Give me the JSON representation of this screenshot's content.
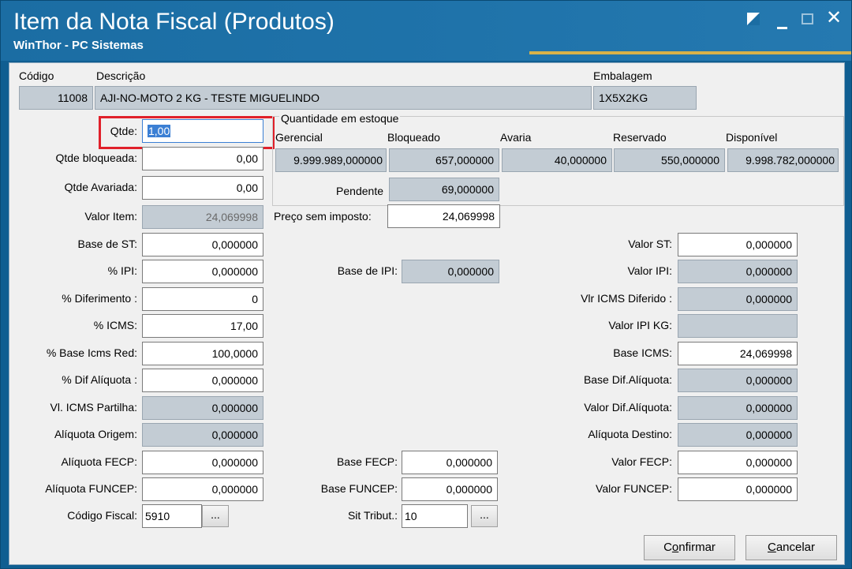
{
  "window": {
    "title": "Item da Nota Fiscal (Produtos)",
    "subtitle": "WinThor - PC Sistemas"
  },
  "header": {
    "codigo_label": "Código",
    "codigo_value": "11008",
    "descricao_label": "Descrição",
    "descricao_value": "AJI-NO-MOTO 2 KG - TESTE MIGUELINDO",
    "embalagem_label": "Embalagem",
    "embalagem_value": "1X5X2KG"
  },
  "left": {
    "qtde_label": "Qtde:",
    "qtde_value": "1,00",
    "qtde_bloqueada_label": "Qtde bloqueada:",
    "qtde_bloqueada_value": "0,00",
    "qtde_avariada_label": "Qtde Avariada:",
    "qtde_avariada_value": "0,00",
    "valor_item_label": "Valor Item:",
    "valor_item_value": "24,069998",
    "base_st_label": "Base de ST:",
    "base_st_value": "0,000000",
    "pct_ipi_label": "% IPI:",
    "pct_ipi_value": "0,000000",
    "pct_diferimento_label": "% Diferimento :",
    "pct_diferimento_value": "0",
    "pct_icms_label": "% ICMS:",
    "pct_icms_value": "17,00",
    "pct_base_icms_red_label": "% Base Icms Red:",
    "pct_base_icms_red_value": "100,0000",
    "pct_dif_aliquota_label": "% Dif Alíquota :",
    "pct_dif_aliquota_value": "0,000000",
    "vl_icms_partilha_label": "Vl. ICMS Partilha:",
    "vl_icms_partilha_value": "0,000000",
    "aliquota_origem_label": "Alíquota Origem:",
    "aliquota_origem_value": "0,000000",
    "aliquota_fecp_label": "Alíquota FECP:",
    "aliquota_fecp_value": "0,000000",
    "aliquota_funcep_label": "Alíquota FUNCEP:",
    "aliquota_funcep_value": "0,000000",
    "codigo_fiscal_label": "Código Fiscal:",
    "codigo_fiscal_value": "5910",
    "codigo_fiscal_button": "..."
  },
  "stock": {
    "group_title": "Quantidade em estoque",
    "gerencial_label": "Gerencial",
    "gerencial_value": "9.999.989,000000",
    "bloqueado_label": "Bloqueado",
    "bloqueado_value": "657,000000",
    "avaria_label": "Avaria",
    "avaria_value": "40,000000",
    "reservado_label": "Reservado",
    "reservado_value": "550,000000",
    "disponivel_label": "Disponível",
    "disponivel_value": "9.998.782,000000",
    "pendente_label": "Pendente",
    "pendente_value": "69,000000"
  },
  "middle": {
    "preco_sem_imposto_label": "Preço sem imposto:",
    "preco_sem_imposto_value": "24,069998",
    "base_ipi_label": "Base de IPI:",
    "base_ipi_value": "0,000000",
    "base_fecp_label": "Base FECP:",
    "base_fecp_value": "0,000000",
    "base_funcep_label": "Base FUNCEP:",
    "base_funcep_value": "0,000000",
    "sit_tribut_label": "Sit Tribut.:",
    "sit_tribut_value": "10",
    "sit_tribut_button": "..."
  },
  "right": {
    "valor_st_label": "Valor ST:",
    "valor_st_value": "0,000000",
    "valor_ipi_label": "Valor IPI:",
    "valor_ipi_value": "0,000000",
    "vlr_icms_diferido_label": "Vlr ICMS Diferido :",
    "vlr_icms_diferido_value": "0,000000",
    "valor_ipi_kg_label": "Valor IPI KG:",
    "valor_ipi_kg_value": "",
    "base_icms_label": "Base ICMS:",
    "base_icms_value": "24,069998",
    "base_dif_aliquota_label": "Base Dif.Alíquota:",
    "base_dif_aliquota_value": "0,000000",
    "valor_dif_aliquota_label": "Valor Dif.Alíquota:",
    "valor_dif_aliquota_value": "0,000000",
    "aliquota_destino_label": "Alíquota Destino:",
    "aliquota_destino_value": "0,000000",
    "valor_fecp_label": "Valor FECP:",
    "valor_fecp_value": "0,000000",
    "valor_funcep_label": "Valor FUNCEP:",
    "valor_funcep_value": "0,000000"
  },
  "buttons": {
    "confirmar_pre": "C",
    "confirmar_underlined": "o",
    "confirmar_post": "nfirmar",
    "cancelar_pre": "",
    "cancelar_underlined": "C",
    "cancelar_post": "ancelar"
  },
  "colors": {
    "titlebar": "#1b6da3",
    "readonly_field": "#c3ccd4",
    "highlight": "#e0202a"
  }
}
